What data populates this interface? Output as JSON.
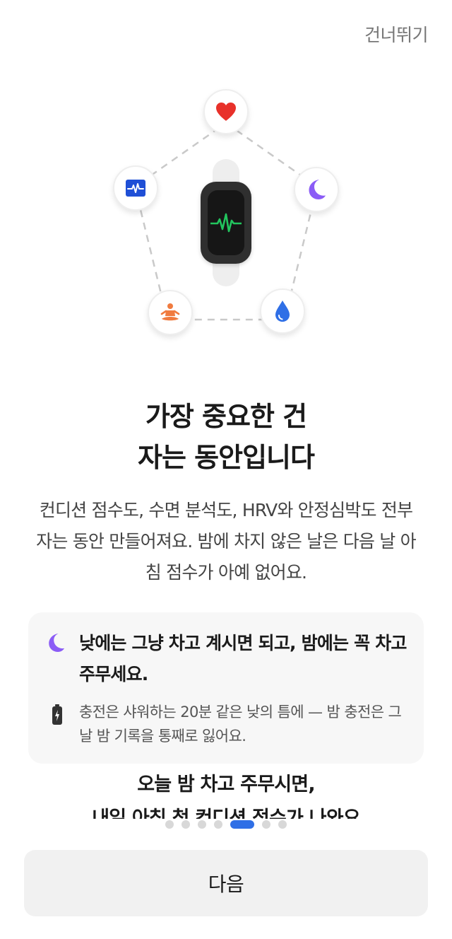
{
  "header": {
    "skip_label": "건너뛰기"
  },
  "illustration": {
    "icons": [
      "heart-icon",
      "moon-icon",
      "water-drop-icon",
      "meditation-icon",
      "ecg-monitor-icon",
      "watch-heartbeat-icon"
    ],
    "colors": {
      "heart": "#e8312a",
      "moon": "#8b5cf6",
      "drop": "#2f6fe6",
      "yoga": "#f07b3f",
      "ecg": "#1f4fd6",
      "pulse": "#22c55e"
    }
  },
  "title": {
    "line1": "가장 중요한 건",
    "line2": "자는 동안입니다"
  },
  "description": "컨디션 점수도, 수면 분석도, HRV와 안정심박도 전부 자는 동안 만들어져요. 밤에 차지 않은 날은 다음 날 아침 점수가 아예 없어요.",
  "tip_card": {
    "headline": "낮에는 그냥 차고 계시면 되고, 밤에는 꼭 차고 주무세요.",
    "note": "충전은 샤워하는 20분 같은 낮의 틈에 — 밤 충전은 그 날 밤 기록을 통째로 잃어요."
  },
  "callout": {
    "line1": "오늘 밤 차고 주무시면,",
    "line2": "내일 아침 첫 컨디션 점수가 나와요"
  },
  "pagination": {
    "total": 7,
    "active_index": 4
  },
  "footer": {
    "next_label": "다음"
  }
}
